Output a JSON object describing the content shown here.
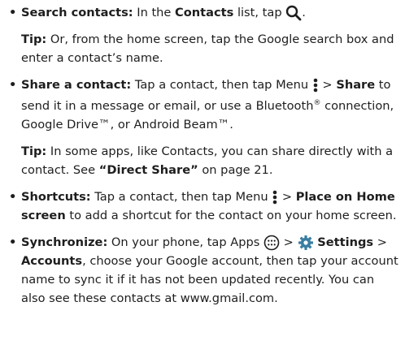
{
  "items": [
    {
      "label": "Search contacts:",
      "t1": " In the ",
      "b1": "Contacts",
      "t2": " list, tap ",
      "icon": "search-icon"
    },
    {
      "tip_label": "Tip:",
      "tip_text": " Or, from the home screen, tap the Google search box and enter a contact’s name."
    },
    {
      "label": "Share a contact:",
      "t1": " Tap a contact, then tap Menu ",
      "icon": "menu-icon",
      "t2": " > ",
      "b1": "Share",
      "t3": " to send it in a message or email, or use a Bluetooth",
      "sup1": "®",
      "t4": " connection, Google Drive™, or Android Beam™."
    },
    {
      "tip_label": "Tip:",
      "tip_text": " In some apps, like Contacts, you can share directly with a contact. See ",
      "tip_link": "“Direct Share”",
      "tip_end": " on page 21."
    },
    {
      "label": "Shortcuts:",
      "t1": " Tap a contact, then tap Menu ",
      "icon": "menu-icon",
      "t2": " > ",
      "b1": "Place on Home screen",
      "t3": " to add a shortcut for the contact on your home screen."
    },
    {
      "label": "Synchronize:",
      "t1": " On your phone, tap Apps ",
      "icon1": "apps-icon",
      "t2": " > ",
      "icon2": "settings-icon",
      "b1": "Settings",
      "t3": " > ",
      "b2": "Accounts",
      "t4": ", choose your Google account, then tap your account name to sync it if it has not been updated recently. You can also see these contacts at www.gmail.com."
    }
  ],
  "bullet_char": "•",
  "colors": {
    "text": "#1e1e1e",
    "settings_icon": "#3a7ea1"
  }
}
